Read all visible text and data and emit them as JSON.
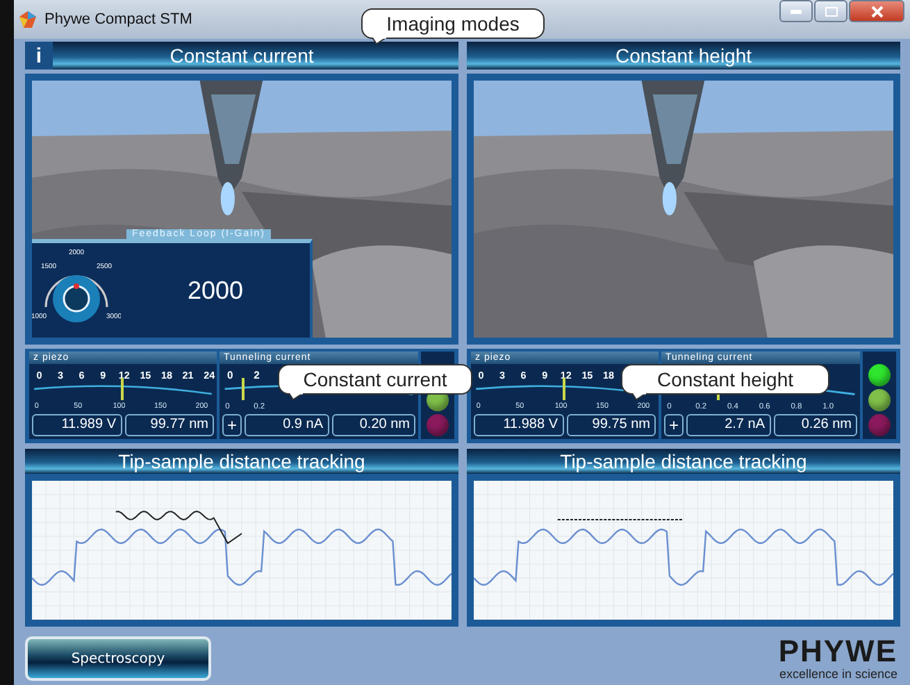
{
  "window": {
    "title": "Phywe Compact STM"
  },
  "info_button": "i",
  "callouts": [
    {
      "text": "Imaging modes",
      "kind": "top"
    },
    {
      "text": "Constant current",
      "kind": "left"
    },
    {
      "text": "Constant height",
      "kind": "right"
    }
  ],
  "modes": [
    {
      "title": "Constant current",
      "feedback": {
        "title": "Feedback Loop (I-Gain)",
        "value": "2000",
        "dial_labels": [
          "1000",
          "1500",
          "2000",
          "2500",
          "3000"
        ]
      },
      "z_piezo": {
        "title": "z piezo",
        "top_labels": [
          "0",
          "3",
          "6",
          "9",
          "12",
          "15",
          "18",
          "21",
          "24"
        ],
        "bottom_labels": [
          "0",
          "50",
          "100",
          "150",
          "200"
        ],
        "level": 0.5,
        "voltage": "11.989 V",
        "position": "99.77 nm"
      },
      "tunneling": {
        "title": "Tunneling current",
        "top_labels": [
          "0",
          "2"
        ],
        "bottom_labels": [
          "0",
          "0.2"
        ],
        "level": 0.08,
        "sign": "+",
        "current": "0.9 nA",
        "distance": "0.20 nm"
      },
      "lights": [
        {
          "color": "#7fbf4a"
        },
        {
          "color": "#8a1a5c"
        }
      ],
      "tracking": {
        "title": "Tip-sample distance tracking",
        "kind": "wave"
      }
    },
    {
      "title": "Constant height",
      "z_piezo": {
        "title": "z piezo",
        "top_labels": [
          "0",
          "3",
          "6",
          "9",
          "12",
          "15",
          "18"
        ],
        "bottom_labels": [
          "0",
          "50",
          "100",
          "150",
          "200"
        ],
        "level": 0.5,
        "voltage": "11.988 V",
        "position": "99.75 nm"
      },
      "tunneling": {
        "title": "Tunneling current",
        "bottom_labels": [
          "0",
          "0.2",
          "0.4",
          "0.6",
          "0.8",
          "1.0"
        ],
        "level": 0.27,
        "sign": "+",
        "current": "2.7 nA",
        "distance": "0.26 nm"
      },
      "lights": [
        {
          "color": "#2ee62e"
        },
        {
          "color": "#7fbf4a"
        },
        {
          "color": "#8a1a5c"
        }
      ],
      "tracking": {
        "title": "Tip-sample distance tracking",
        "kind": "flat"
      }
    }
  ],
  "spectroscopy_button": "Spectroscopy",
  "logo": {
    "name": "PHYWE",
    "tagline": "excellence in science"
  }
}
